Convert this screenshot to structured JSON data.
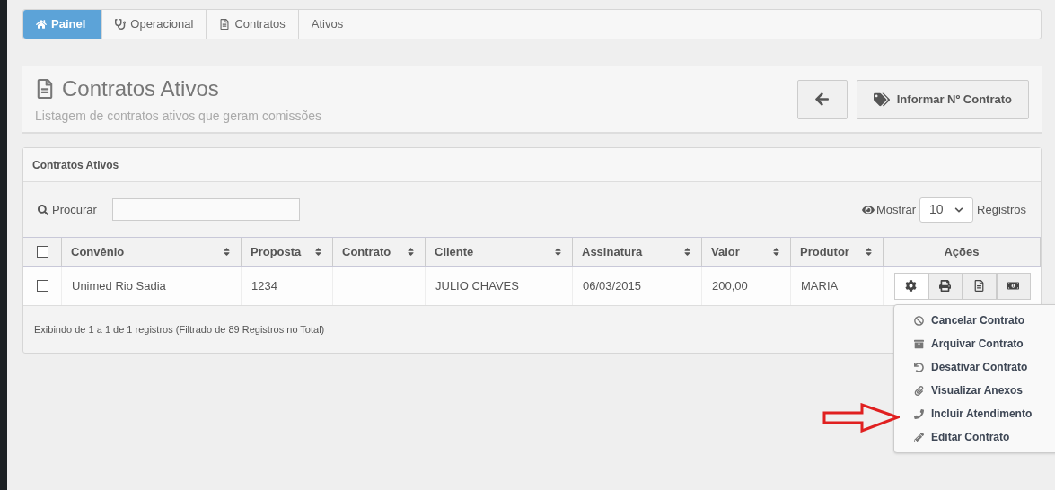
{
  "breadcrumb": [
    {
      "label": "Painel",
      "selected": true
    },
    {
      "label": "Operacional",
      "selected": false
    },
    {
      "label": "Contratos",
      "selected": false
    },
    {
      "label": "Ativos",
      "selected": false
    }
  ],
  "header": {
    "title": "Contratos Ativos",
    "subtitle": "Listagem de contratos ativos que geram comissões",
    "buttons": [
      "Informar Nº Contrato"
    ]
  },
  "panel": {
    "title": "Contratos Ativos",
    "search": {
      "label": "Procurar"
    },
    "page_size": {
      "label_before": "Mostrar",
      "value": "10",
      "label_after": "Registros"
    },
    "table": {
      "select_all_checked": false,
      "columns": [
        {
          "label": "Convênio",
          "sortable": true
        },
        {
          "label": "Proposta",
          "sortable": true
        },
        {
          "label": "Contrato",
          "sortable": true
        },
        {
          "label": "Cliente",
          "sortable": true
        },
        {
          "label": "Assinatura",
          "sortable": true
        },
        {
          "label": "Valor",
          "sortable": true
        },
        {
          "label": "Produtor",
          "sortable": true
        },
        {
          "label": "Ações",
          "sortable": false
        }
      ],
      "rows": [
        {
          "checked": false,
          "cells": [
            "Unimed Rio Sadia",
            "1234",
            "",
            "JULIO CHAVES",
            "06/03/2015",
            "200,00",
            "MARIA"
          ]
        }
      ]
    },
    "footer": "Exibindo de 1 a 1 de 1 registros (Filtrado de 89 Registros no Total)"
  },
  "actions_menu": {
    "items": [
      "Cancelar Contrato",
      "Arquivar Contrato",
      "Desativar Contrato",
      "Visualizar Anexos",
      "Incluir Atendimento",
      "Editar Contrato"
    ]
  }
}
